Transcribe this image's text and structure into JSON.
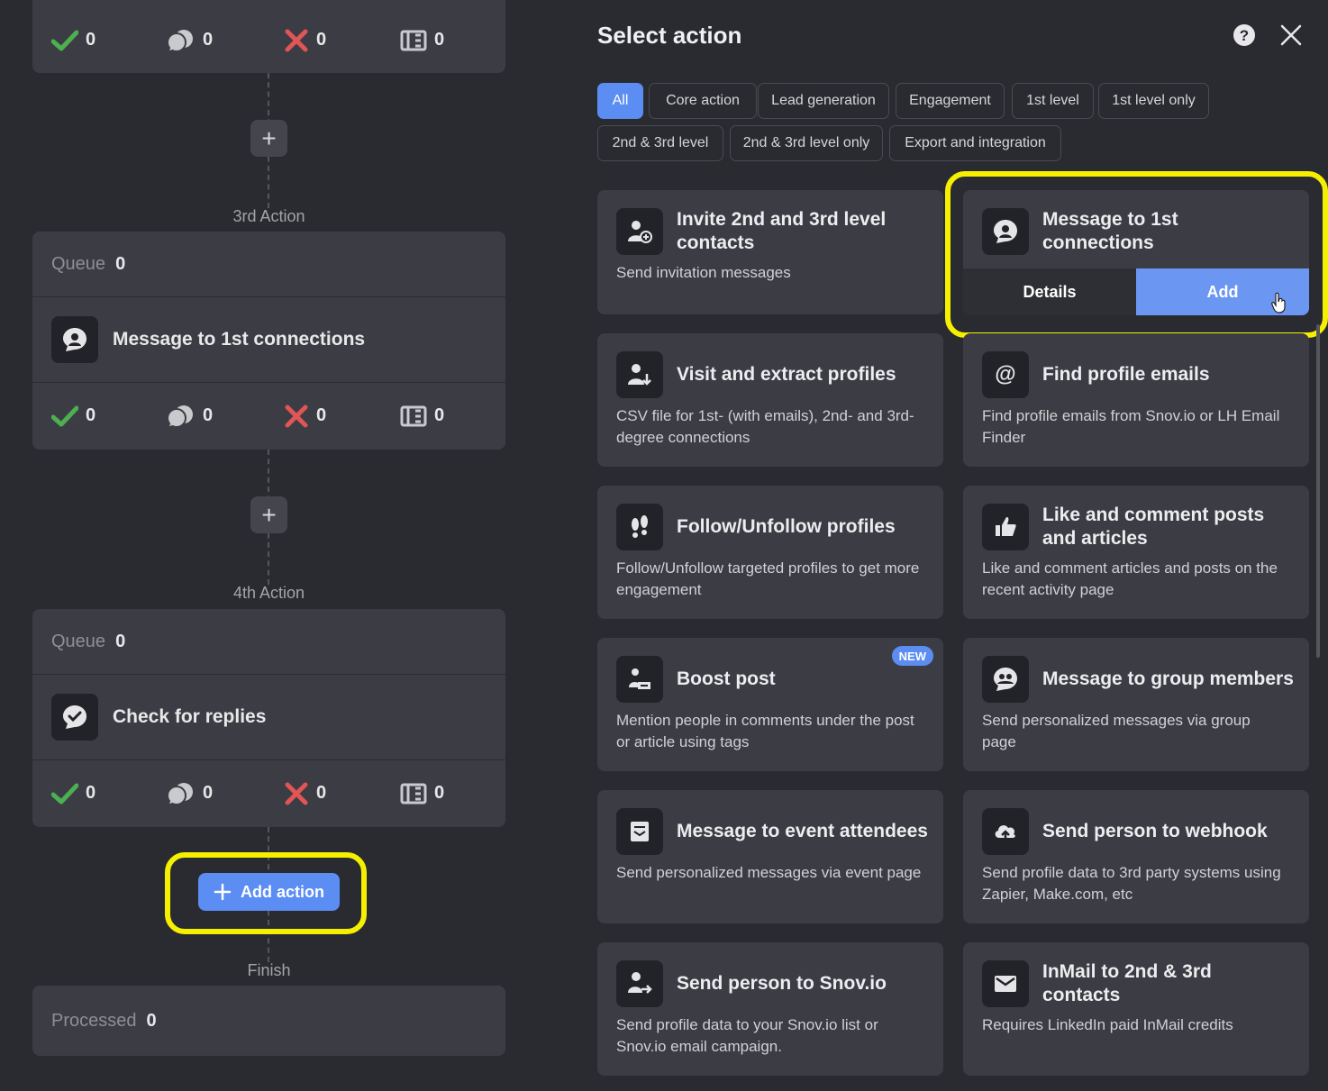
{
  "colors": {
    "background": "#2a2b31",
    "panel": "#3c3d44",
    "accent": "#5b8df3",
    "highlight": "#f6f000",
    "success": "#4caf50",
    "fail": "#e05555"
  },
  "workflow": {
    "top_stats": {
      "success": "0",
      "replied": "0",
      "failed": "0",
      "skipped": "0"
    },
    "action3": {
      "stage_label": "3rd Action",
      "queue_label": "Queue",
      "queue_count": "0",
      "name": "Message to 1st connections",
      "icon": "message-person-icon",
      "stats": {
        "success": "0",
        "replied": "0",
        "failed": "0",
        "skipped": "0"
      }
    },
    "action4": {
      "stage_label": "4th Action",
      "queue_label": "Queue",
      "queue_count": "0",
      "name": "Check for replies",
      "icon": "check-replies-icon",
      "stats": {
        "success": "0",
        "replied": "0",
        "failed": "0",
        "skipped": "0"
      }
    },
    "add_action_label": "Add action",
    "finish": {
      "stage_label": "Finish",
      "processed_label": "Processed",
      "processed_count": "0"
    }
  },
  "drawer": {
    "title": "Select action",
    "filters": [
      {
        "label": "All",
        "active": true
      },
      {
        "label": "Core action"
      },
      {
        "label": "Lead generation"
      },
      {
        "label": "Engagement"
      },
      {
        "label": "1st level"
      },
      {
        "label": "1st level only"
      },
      {
        "label": "2nd & 3rd level"
      },
      {
        "label": "2nd & 3rd level only"
      },
      {
        "label": "Export and integration"
      }
    ],
    "cards": [
      {
        "title": "Invite 2nd and 3rd level contacts",
        "desc": "Send invitation messages",
        "icon": "invite-person-icon"
      },
      {
        "title": "Message to 1st connections",
        "details_label": "Details",
        "add_label": "Add",
        "icon": "message-person-icon"
      },
      {
        "title": "Visit and extract profiles",
        "desc": "CSV file for 1st- (with emails), 2nd- and 3rd-degree connections",
        "icon": "extract-profile-icon"
      },
      {
        "title": "Find profile emails",
        "desc": "Find profile emails from Snov.io or LH Email Finder",
        "icon": "at-sign-icon"
      },
      {
        "title": "Follow/Unfollow profiles",
        "desc": "Follow/Unfollow targeted profiles to get more engagement",
        "icon": "footsteps-icon"
      },
      {
        "title": "Like and comment posts and articles",
        "desc": "Like and comment articles and posts on the recent activity page",
        "icon": "thumbs-up-icon"
      },
      {
        "title": "Boost post",
        "desc": "Mention people in comments under the post or article using tags",
        "badge": "NEW",
        "icon": "boost-post-icon"
      },
      {
        "title": "Message to group members",
        "desc": "Send personalized messages via group page",
        "icon": "group-message-icon"
      },
      {
        "title": "Message to event attendees",
        "desc": "Send personalized messages via event page",
        "icon": "event-message-icon"
      },
      {
        "title": "Send person to webhook",
        "desc": "Send profile data to 3rd party systems using Zapier, Make.com, etc",
        "icon": "cloud-upload-icon"
      },
      {
        "title": "Send person to Snov.io",
        "desc": "Send profile data to your Snov.io list or Snov.io email campaign.",
        "icon": "send-person-icon"
      },
      {
        "title": "InMail to 2nd & 3rd contacts",
        "desc": "Requires LinkedIn paid InMail credits",
        "icon": "envelope-icon"
      }
    ]
  }
}
